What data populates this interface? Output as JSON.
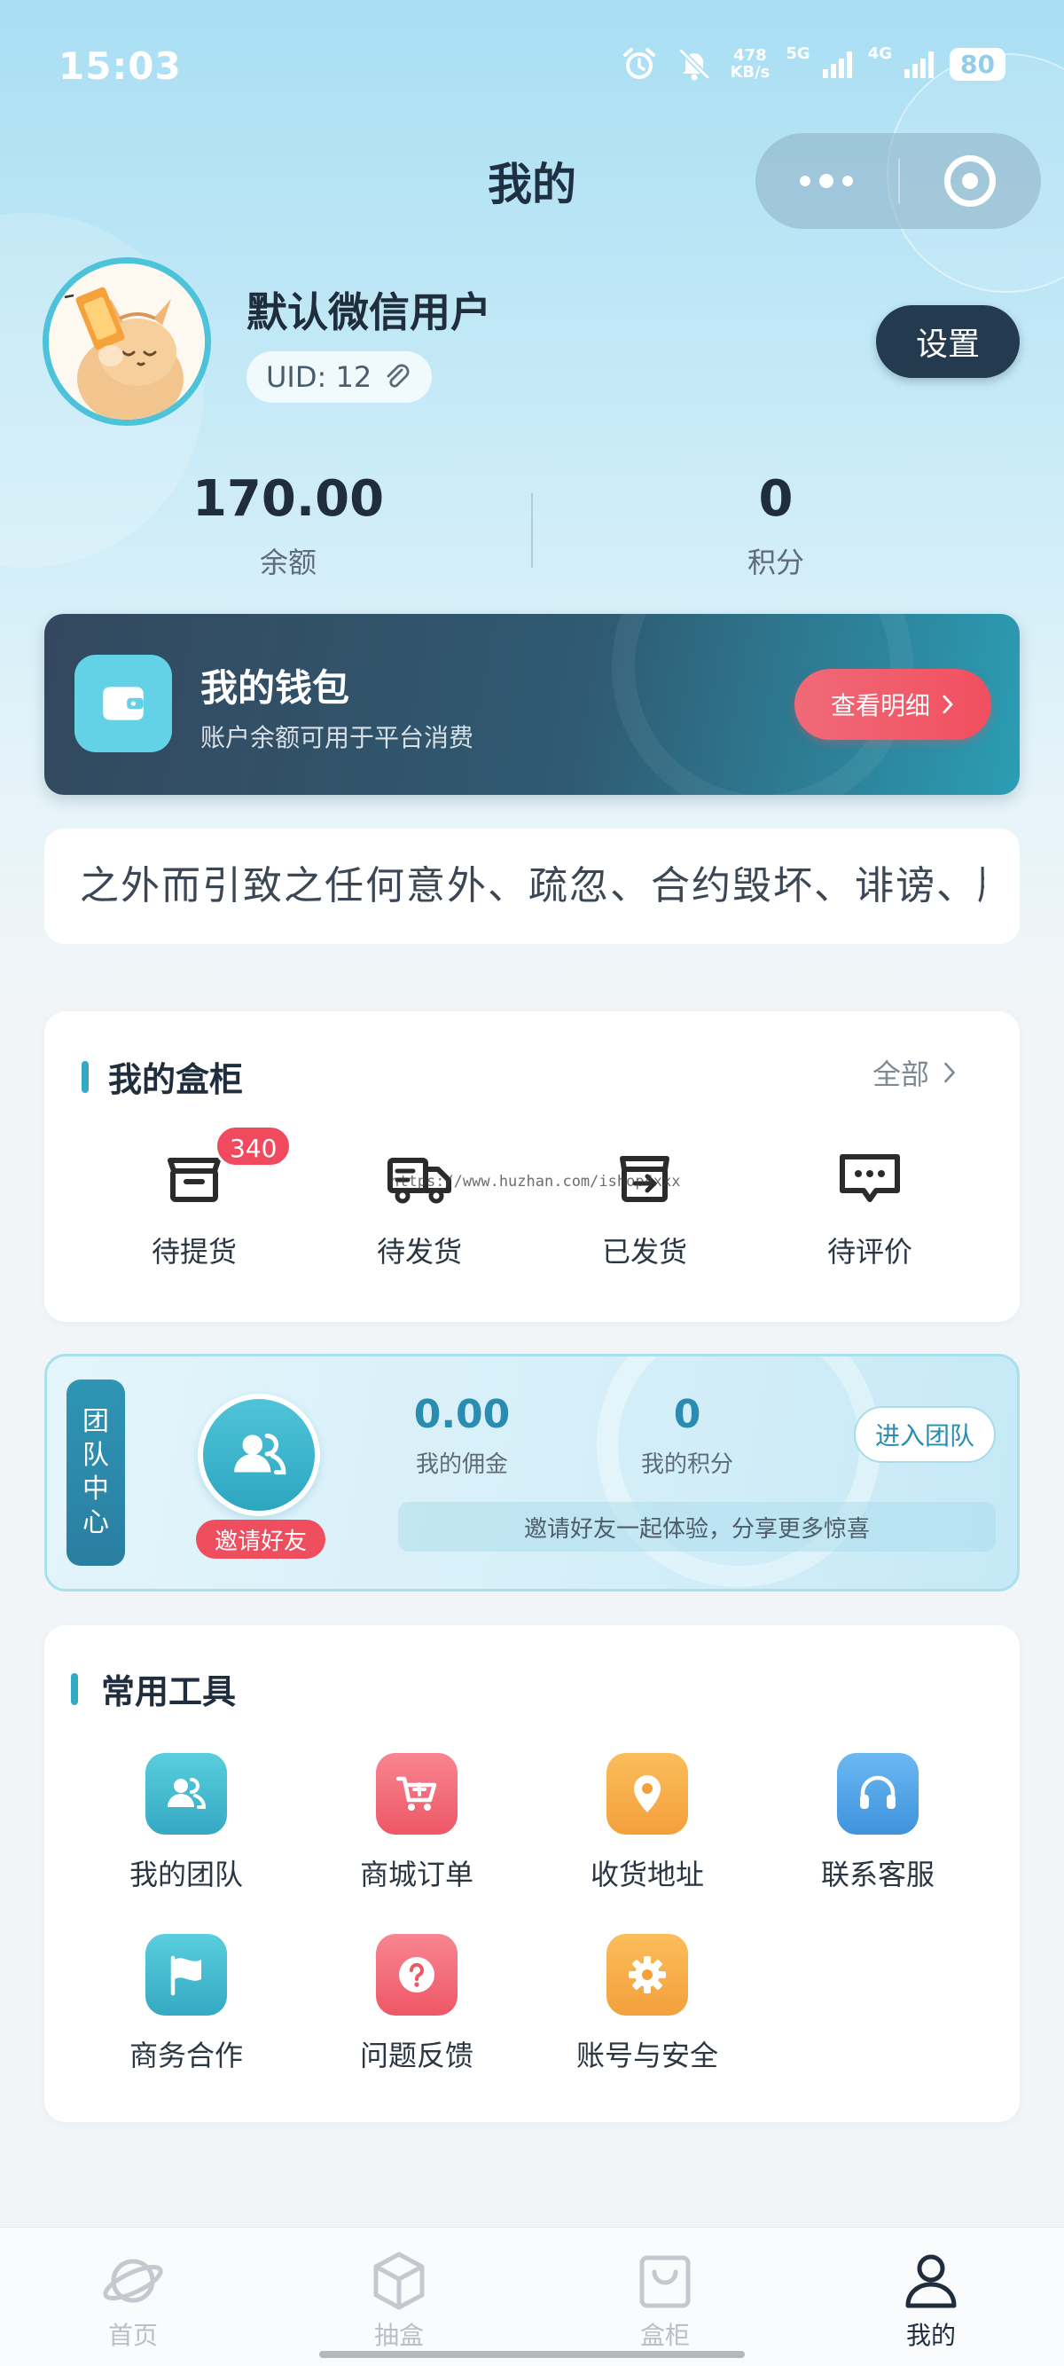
{
  "status_bar": {
    "time": "15:03",
    "net_speed_value": "478",
    "net_speed_unit": "KB/s",
    "network_1": "5G",
    "network_2": "4G",
    "battery": "80"
  },
  "header": {
    "title": "我的"
  },
  "profile": {
    "name": "默认微信用户",
    "uid": "UID: 12",
    "settings_label": "设置"
  },
  "stats": [
    {
      "value": "170.00",
      "label": "余额"
    },
    {
      "value": "0",
      "label": "积分"
    }
  ],
  "wallet": {
    "title": "我的钱包",
    "subtitle": "账户余额可用于平台消费",
    "button_label": "查看明细"
  },
  "marquee": {
    "text": "之外而引致之任何意外、疏忽、合约毁坏、诽谤、版"
  },
  "locker": {
    "title": "我的盒柜",
    "see_all": "全部",
    "badge_count": "340",
    "items": [
      {
        "label": "待提货",
        "icon": "box-icon"
      },
      {
        "label": "待发货",
        "icon": "truck-icon"
      },
      {
        "label": "已发货",
        "icon": "box-out-icon"
      },
      {
        "label": "待评价",
        "icon": "comment-icon"
      }
    ]
  },
  "watermark": "https://www.huzhan.com/ishop4xxx",
  "team": {
    "tab_label": [
      "团",
      "队",
      "中",
      "心"
    ],
    "invite_label": "邀请好友",
    "commission_value": "0.00",
    "commission_label": "我的佣金",
    "points_value": "0",
    "points_label": "我的积分",
    "join_label": "进入团队",
    "note": "邀请好友一起体验，分享更多惊喜"
  },
  "tools": {
    "title": "常用工具",
    "items": [
      {
        "label": "我的团队",
        "icon": "team-icon",
        "color": "#35a9c2"
      },
      {
        "label": "商城订单",
        "icon": "cart-icon",
        "color": "#ee5766"
      },
      {
        "label": "收货地址",
        "icon": "location-icon",
        "color": "#f3a03b"
      },
      {
        "label": "联系客服",
        "icon": "headset-icon",
        "color": "#3f93dd"
      },
      {
        "label": "商务合作",
        "icon": "flag-icon",
        "color": "#35a9c2"
      },
      {
        "label": "问题反馈",
        "icon": "question-icon",
        "color": "#ee5766"
      },
      {
        "label": "账号与安全",
        "icon": "gear-icon",
        "color": "#f3a03b"
      }
    ]
  },
  "tabbar": {
    "items": [
      {
        "label": "首页",
        "icon": "planet-icon"
      },
      {
        "label": "抽盒",
        "icon": "cube-icon"
      },
      {
        "label": "盒柜",
        "icon": "bag-icon"
      },
      {
        "label": "我的",
        "icon": "user-icon"
      }
    ],
    "active_index": 3
  }
}
